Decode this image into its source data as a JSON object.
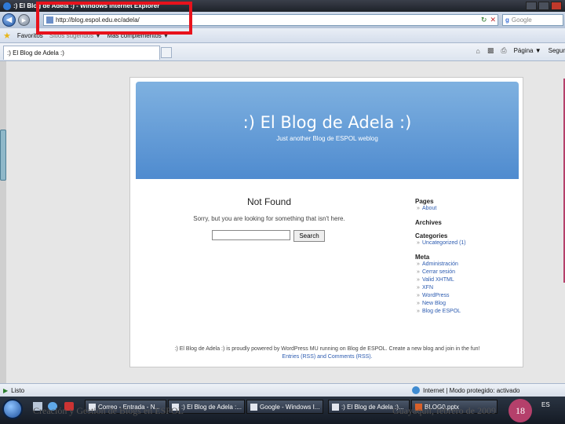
{
  "window": {
    "title": ":) El Blog de Adela :) - Windows Internet Explorer"
  },
  "address": {
    "url": "http://blog.espol.edu.ec/adela/",
    "search_placeholder": "Google"
  },
  "favorites_bar": {
    "favorites_label": "Favoritos",
    "suggested_label": "Sitios sugeridos",
    "addons_label": "Más complementos"
  },
  "tab": {
    "label": ":) El Blog de Adela :)"
  },
  "command_bar": {
    "page_label": "Página",
    "security_label": "Segur"
  },
  "blog": {
    "title": ":) El Blog de Adela :)",
    "tagline": "Just another Blog de ESPOL weblog",
    "not_found": "Not Found",
    "sorry_text": "Sorry, but you are looking for something that isn't here.",
    "search_button": "Search",
    "sidebar": {
      "pages_heading": "Pages",
      "pages": [
        "About"
      ],
      "archives_heading": "Archives",
      "categories_heading": "Categories",
      "categories": [
        "Uncategorized (1)"
      ],
      "meta_heading": "Meta",
      "meta": [
        "Administración",
        "Cerrar sesión",
        "Valid XHTML",
        "XFN",
        "WordPress",
        "New Blog",
        "Blog de ESPOL"
      ]
    },
    "footer": {
      "line1": ":) El Blog de Adela :) is proudly powered by WordPress MU running on Blog de ESPOL. Create a new blog and join in the fun!",
      "line2": "Entries (RSS) and Comments (RSS)."
    }
  },
  "status_bar": {
    "status": "Listo",
    "zone": "Internet | Modo protegido: activado"
  },
  "taskbar": {
    "items": [
      "Correo - Entrada - N...",
      ":) El Blog de Adela :...",
      "Google - Windows I...",
      ":) El Blog de Adela :)...",
      "BLOG0.pptx"
    ],
    "tray_lang": "ES"
  },
  "slide": {
    "footer_left": "Creación y Gestión de Blogs en ESPOL",
    "footer_right": "Guayaquil, febrero de 2009",
    "page_number": "18"
  },
  "colors": {
    "highlight_border": "#e8121c",
    "header_blue": "#5b95d4",
    "slide_accent": "#b5406b"
  }
}
